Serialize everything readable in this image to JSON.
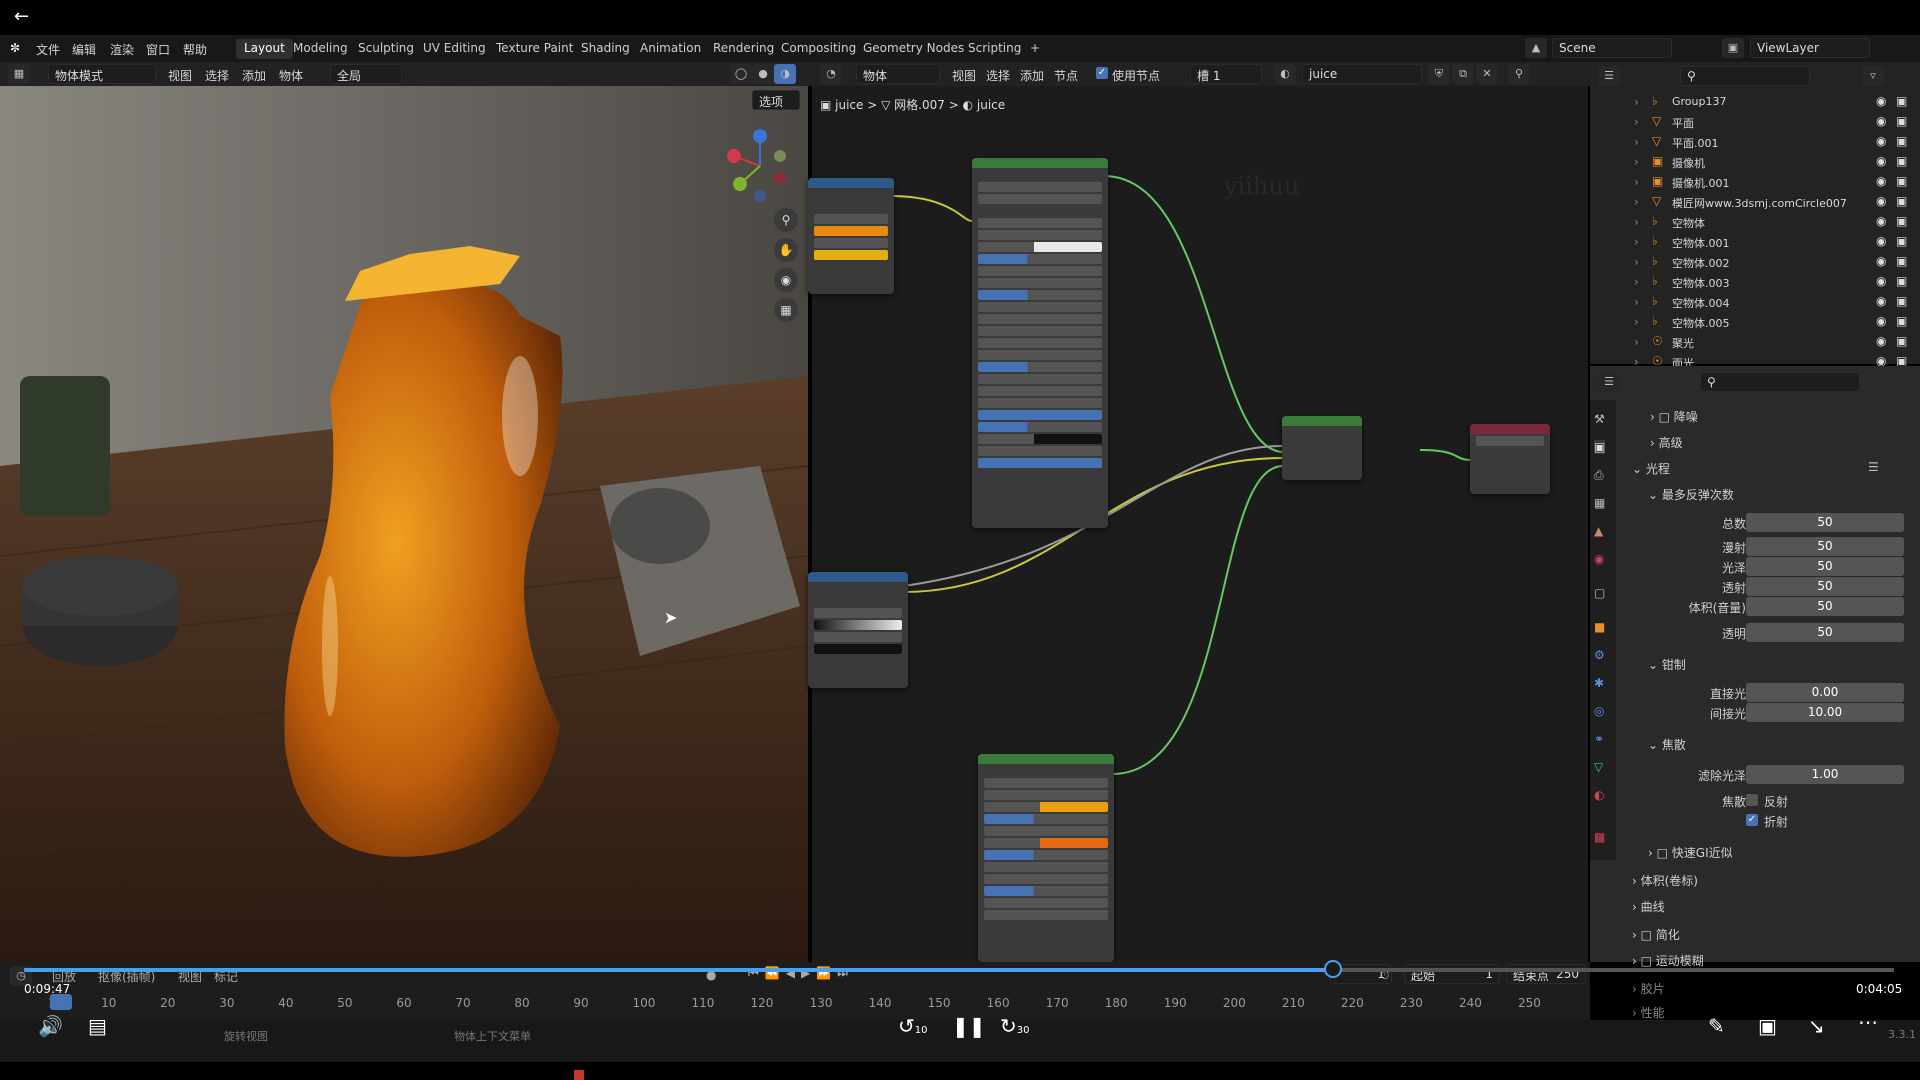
{
  "player": {
    "elapsed": "0:09:47",
    "remaining": "0:04:05",
    "skip_back": "10",
    "skip_fwd": "30",
    "progress": 0.7
  },
  "menu": {
    "items": [
      "文件",
      "编辑",
      "渲染",
      "窗口",
      "帮助"
    ],
    "workspaces": [
      "Layout",
      "Modeling",
      "Sculpting",
      "UV Editing",
      "Texture Paint",
      "Shading",
      "Animation",
      "Rendering",
      "Compositing",
      "Geometry Nodes",
      "Scripting",
      "+"
    ],
    "active_workspace": "Layout",
    "scene": "Scene",
    "view_layer": "ViewLayer"
  },
  "viewport_header": {
    "mode": "物体模式",
    "menus": [
      "视图",
      "选择",
      "添加",
      "物体"
    ],
    "transform": "全局",
    "options": "选项"
  },
  "node_header": {
    "object_type": "物体",
    "menus": [
      "视图",
      "选择",
      "添加",
      "节点"
    ],
    "use_nodes": "使用节点",
    "slot": "槽 1",
    "material": "juice",
    "watermark": "yiihuu"
  },
  "breadcrumbs": [
    "juice",
    "网格.007",
    "juice"
  ],
  "outliner": {
    "rows": [
      {
        "name": "Group137",
        "icon": "empty-icon"
      },
      {
        "name": "平面",
        "icon": "mesh-icon"
      },
      {
        "name": "平面.001",
        "icon": "mesh-icon"
      },
      {
        "name": "摄像机",
        "icon": "camera-icon"
      },
      {
        "name": "摄像机.001",
        "icon": "camera-icon"
      },
      {
        "name": "模匠网www.3dsmj.comCircle007",
        "icon": "mesh-icon"
      },
      {
        "name": "空物体",
        "icon": "empty-icon"
      },
      {
        "name": "空物体.001",
        "icon": "empty-icon"
      },
      {
        "name": "空物体.002",
        "icon": "empty-icon"
      },
      {
        "name": "空物体.003",
        "icon": "empty-icon"
      },
      {
        "name": "空物体.004",
        "icon": "empty-icon"
      },
      {
        "name": "空物体.005",
        "icon": "empty-icon"
      },
      {
        "name": "聚光",
        "icon": "light-icon"
      },
      {
        "name": "面光",
        "icon": "light-icon"
      }
    ]
  },
  "properties": {
    "denoise": "降噪",
    "advanced": "高级",
    "light_paths": "光程",
    "max_bounces": "最多反弹次数",
    "bounces": [
      {
        "label": "总数",
        "value": "50"
      },
      {
        "label": "漫射",
        "value": "50"
      },
      {
        "label": "光泽",
        "value": "50"
      },
      {
        "label": "透射",
        "value": "50"
      },
      {
        "label": "体积(音量)",
        "value": "50"
      },
      {
        "label": "透明",
        "value": "50"
      }
    ],
    "clamping": "钳制",
    "clamp": [
      {
        "label": "直接光",
        "value": "0.00"
      },
      {
        "label": "间接光",
        "value": "10.00"
      }
    ],
    "caustics": "焦散",
    "filter_glossy_label": "滤除光泽",
    "filter_glossy": "1.00",
    "caustics_label": "焦散",
    "reflective": "反射",
    "refractive": "折射",
    "fast_gi": "快速GI近似",
    "volumes": "体积(卷标)",
    "curves": "曲线",
    "simplify": "简化",
    "motion_blur": "运动模糊",
    "film": "胶片",
    "performance": "性能"
  },
  "timeline": {
    "menus": [
      "回放",
      "抠像(插帧)",
      "视图",
      "标记"
    ],
    "start_label": "起始",
    "start": "1",
    "end_label": "结束点",
    "end": "250",
    "current": "1",
    "frames": [
      "1",
      "10",
      "20",
      "30",
      "40",
      "50",
      "60",
      "70",
      "80",
      "90",
      "100",
      "110",
      "120",
      "130",
      "140",
      "150",
      "160",
      "170",
      "180",
      "190",
      "200",
      "210",
      "220",
      "230",
      "240",
      "250"
    ]
  },
  "status": {
    "rotate_view": "旋转视图",
    "context_menu": "物体上下文菜单",
    "version": "3.3.1"
  }
}
